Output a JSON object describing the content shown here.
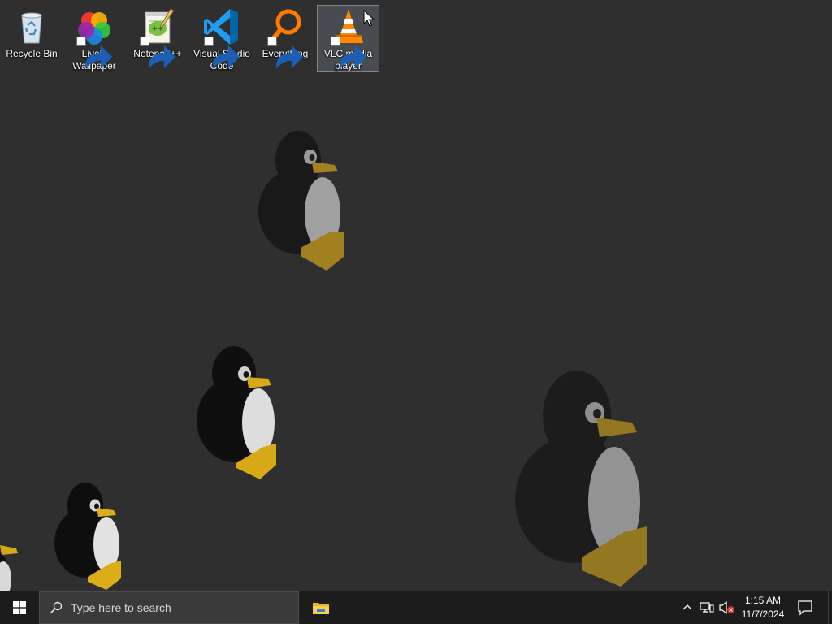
{
  "desktop": {
    "background_color": "#2f2f2f",
    "icons": [
      {
        "label": "Recycle Bin",
        "icon": "recycle-bin-icon",
        "shortcut": false,
        "selected": false
      },
      {
        "label": "Lively Wallpaper",
        "icon": "lively-wallpaper-icon",
        "shortcut": true,
        "selected": false
      },
      {
        "label": "Notepad++",
        "icon": "notepad-plus-plus-icon",
        "shortcut": true,
        "selected": false
      },
      {
        "label": "Visual Studio Code",
        "icon": "vscode-icon",
        "shortcut": true,
        "selected": false
      },
      {
        "label": "Everything",
        "icon": "everything-search-icon",
        "shortcut": true,
        "selected": false
      },
      {
        "label": "VLC media player",
        "icon": "vlc-cone-icon",
        "shortcut": true,
        "selected": true
      }
    ]
  },
  "taskbar": {
    "background_color": "#1c1c1c",
    "start_icon": "windows-logo-icon",
    "search": {
      "placeholder": "Type here to search",
      "icon": "search-icon"
    },
    "pinned": [
      {
        "name": "File Explorer",
        "icon": "file-explorer-icon"
      }
    ],
    "tray": {
      "chevron_icon": "chevron-up-icon",
      "network_icon": "network-icon",
      "volume_icon": "volume-muted-icon"
    },
    "clock": {
      "time": "1:15 AM",
      "date": "11/7/2024"
    },
    "notification_icon": "action-center-icon"
  }
}
